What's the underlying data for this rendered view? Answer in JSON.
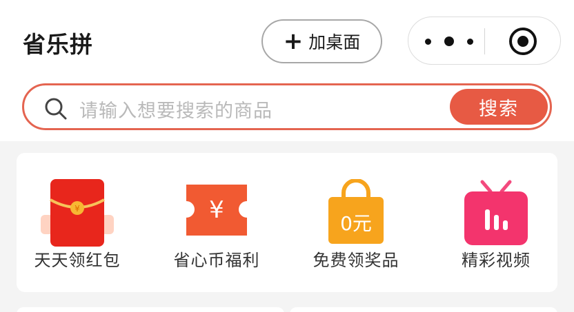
{
  "header": {
    "title": "省乐拼",
    "add_desktop_label": "加桌面"
  },
  "search": {
    "placeholder": "请输入想要搜索的商品",
    "button_label": "搜索"
  },
  "quick_entries": [
    {
      "label": "天天领红包",
      "icon": "red-envelope-icon"
    },
    {
      "label": "省心币福利",
      "icon": "coin-ticket-icon"
    },
    {
      "label": "免费领奖品",
      "icon": "shopping-bag-icon",
      "badge": "0元"
    },
    {
      "label": "精彩视频",
      "icon": "video-tv-icon"
    }
  ],
  "colors": {
    "accent": "#e75a44",
    "search_border": "#e46450"
  }
}
